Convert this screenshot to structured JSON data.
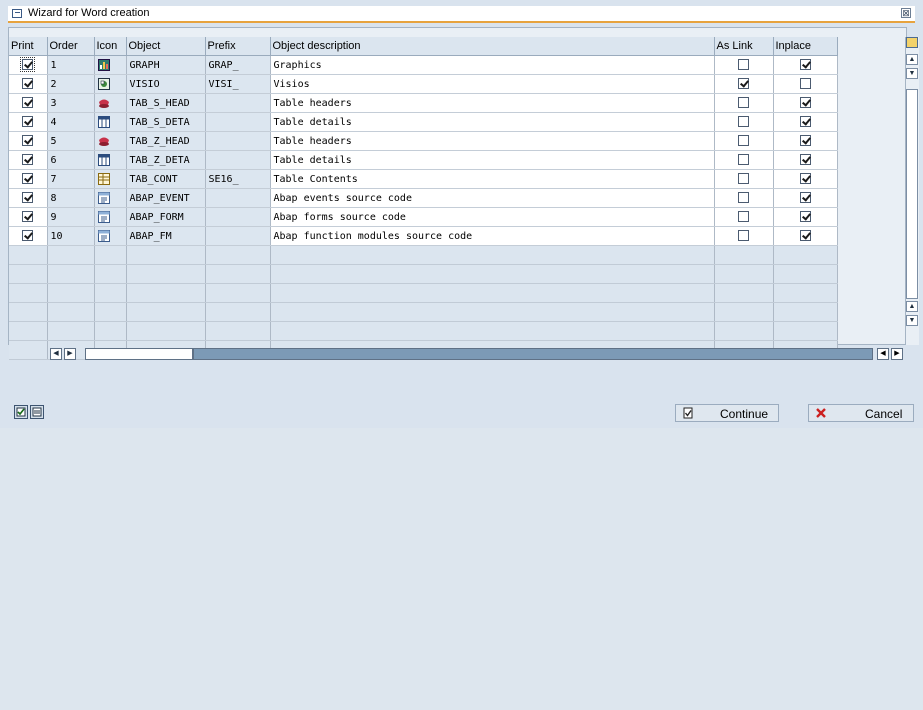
{
  "window": {
    "title": "Wizard for Word creation",
    "close_label": "⊠"
  },
  "columns": [
    "Print",
    "Order",
    "Icon",
    "Object",
    "Prefix",
    "Object description",
    "As Link",
    "Inplace"
  ],
  "rows": [
    {
      "print": true,
      "order": "1",
      "icon": "graph-icon",
      "object": "GRAPH",
      "prefix": "GRAP_",
      "description": "Graphics",
      "as_link": false,
      "inplace": true
    },
    {
      "print": true,
      "order": "2",
      "icon": "visio-icon",
      "object": "VISIO",
      "prefix": "VISI_",
      "description": "Visios",
      "as_link": true,
      "inplace": false
    },
    {
      "print": true,
      "order": "3",
      "icon": "table-header-icon",
      "object": "TAB_S_HEAD",
      "prefix": "",
      "description": "Table headers",
      "as_link": false,
      "inplace": true
    },
    {
      "print": true,
      "order": "4",
      "icon": "table-detail-icon",
      "object": "TAB_S_DETA",
      "prefix": "",
      "description": "Table details",
      "as_link": false,
      "inplace": true
    },
    {
      "print": true,
      "order": "5",
      "icon": "table-header-icon",
      "object": "TAB_Z_HEAD",
      "prefix": "",
      "description": "Table headers",
      "as_link": false,
      "inplace": true
    },
    {
      "print": true,
      "order": "6",
      "icon": "table-detail-icon",
      "object": "TAB_Z_DETA",
      "prefix": "",
      "description": "Table details",
      "as_link": false,
      "inplace": true
    },
    {
      "print": true,
      "order": "7",
      "icon": "table-content-icon",
      "object": "TAB_CONT",
      "prefix": "SE16_",
      "description": "Table Contents",
      "as_link": false,
      "inplace": true
    },
    {
      "print": true,
      "order": "8",
      "icon": "abap-code-icon",
      "object": "ABAP_EVENT",
      "prefix": "",
      "description": "Abap events source code",
      "as_link": false,
      "inplace": true
    },
    {
      "print": true,
      "order": "9",
      "icon": "abap-code-icon",
      "object": "ABAP_FORM",
      "prefix": "",
      "description": "Abap forms source code",
      "as_link": false,
      "inplace": true
    },
    {
      "print": true,
      "order": "10",
      "icon": "abap-code-icon",
      "object": "ABAP_FM",
      "prefix": "",
      "description": "Abap function modules source code",
      "as_link": false,
      "inplace": true
    }
  ],
  "empty_rows": 6,
  "footer": {
    "continue_label": "Continue",
    "cancel_label": "Cancel"
  },
  "colors": {
    "accent": "#e7a33e",
    "cancel_red": "#cc2020",
    "scroll_track": "#7c9ab6"
  }
}
